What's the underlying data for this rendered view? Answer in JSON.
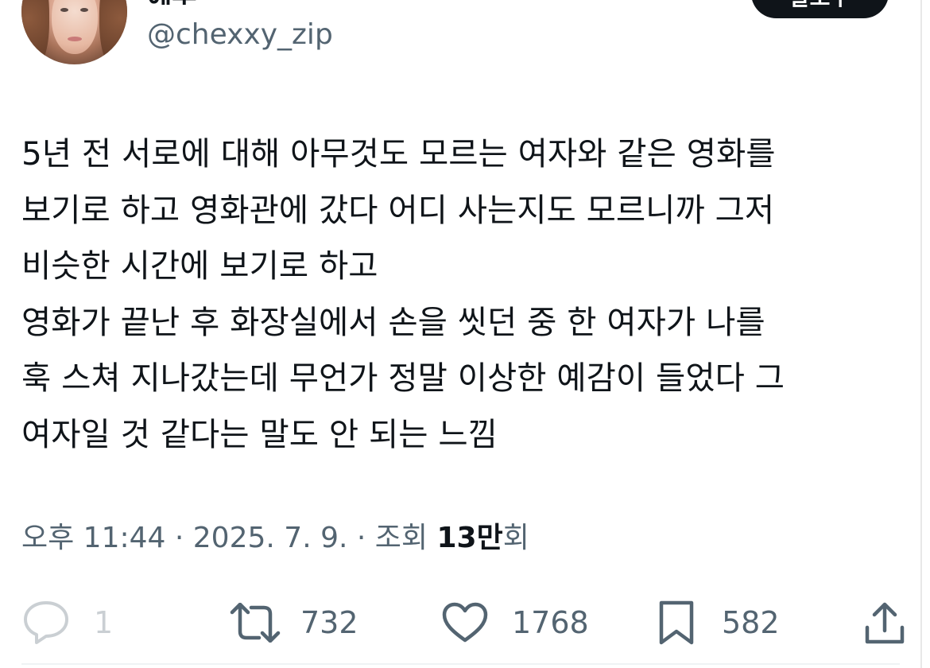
{
  "profile": {
    "display_name": "에우",
    "handle": "@chexxy_zip",
    "follow_label": "팔로우"
  },
  "tweet": {
    "lines": [
      "5년 전 서로에 대해 아무것도 모르는 여자와 같은 영화를",
      "보기로 하고 영화관에 갔다 어디 사는지도 모르니까 그저",
      "비슷한 시간에 보기로 하고",
      "영화가 끝난 후 화장실에서 손을 씻던 중 한 여자가 나를",
      "훅 스쳐 지나갔는데 무언가 정말 이상한 예감이 들었다 그",
      "여자일 것 같다는 말도 안 되는 느낌"
    ]
  },
  "meta": {
    "time": "오후 11:44",
    "separator": " · ",
    "date": "2025. 7. 9.",
    "views_label": "조회",
    "views_number": "13만",
    "views_suffix": "회"
  },
  "actions": {
    "reply": {
      "icon": "reply-icon",
      "count": "1"
    },
    "retweet": {
      "icon": "retweet-icon",
      "count": "732"
    },
    "like": {
      "icon": "heart-icon",
      "count": "1768"
    },
    "bookmark": {
      "icon": "bookmark-icon",
      "count": "582"
    },
    "share": {
      "icon": "share-icon"
    }
  },
  "colors": {
    "text": "#0f1419",
    "secondary": "#536471",
    "button": "#0f1419"
  }
}
